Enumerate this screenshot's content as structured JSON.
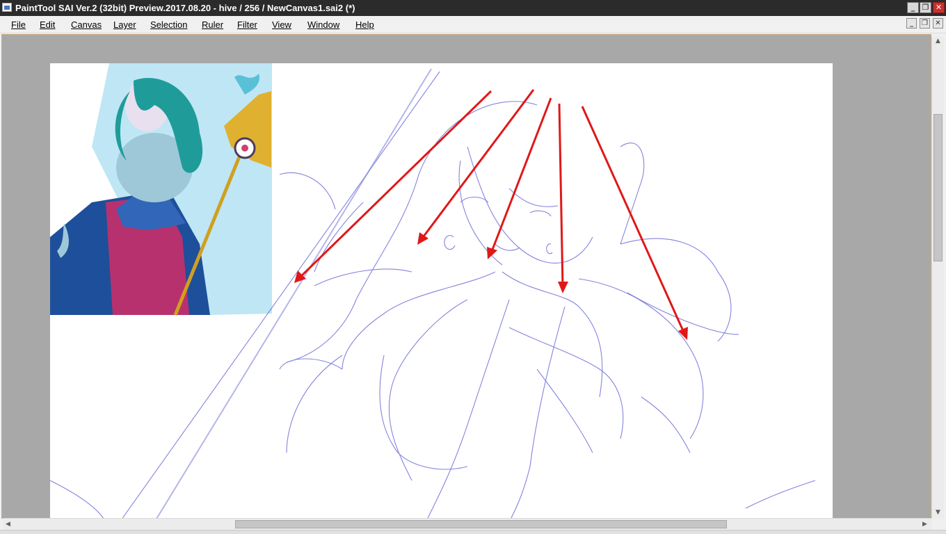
{
  "window": {
    "title": "PaintTool SAI Ver.2 (32bit) Preview.2017.08.20 - hive / 256 / NewCanvas1.sai2 (*)",
    "app_icon": "app-icon",
    "controls": {
      "minimize_glyph": "_",
      "maximize_glyph": "❐",
      "close_glyph": "✕"
    },
    "close_color": "#c9302c"
  },
  "menubar": {
    "items": [
      {
        "label": "File"
      },
      {
        "label": "Edit"
      },
      {
        "label": "Canvas"
      },
      {
        "label": "Layer"
      },
      {
        "label": "Selection"
      },
      {
        "label": "Ruler"
      },
      {
        "label": "Filter"
      },
      {
        "label": "View"
      },
      {
        "label": "Window"
      },
      {
        "label": "Help"
      }
    ]
  },
  "canvas": {
    "background": "#ffffff",
    "workspace_color": "#a8a8a8",
    "sketch_color": "#5a5ad2",
    "arrow_color": "#e01818",
    "reference_image": "mermaid-sorceress-reference",
    "arrow_count": 5
  },
  "scrollbars": {
    "up_glyph": "▲",
    "down_glyph": "▼",
    "left_glyph": "◀",
    "right_glyph": "▶"
  }
}
